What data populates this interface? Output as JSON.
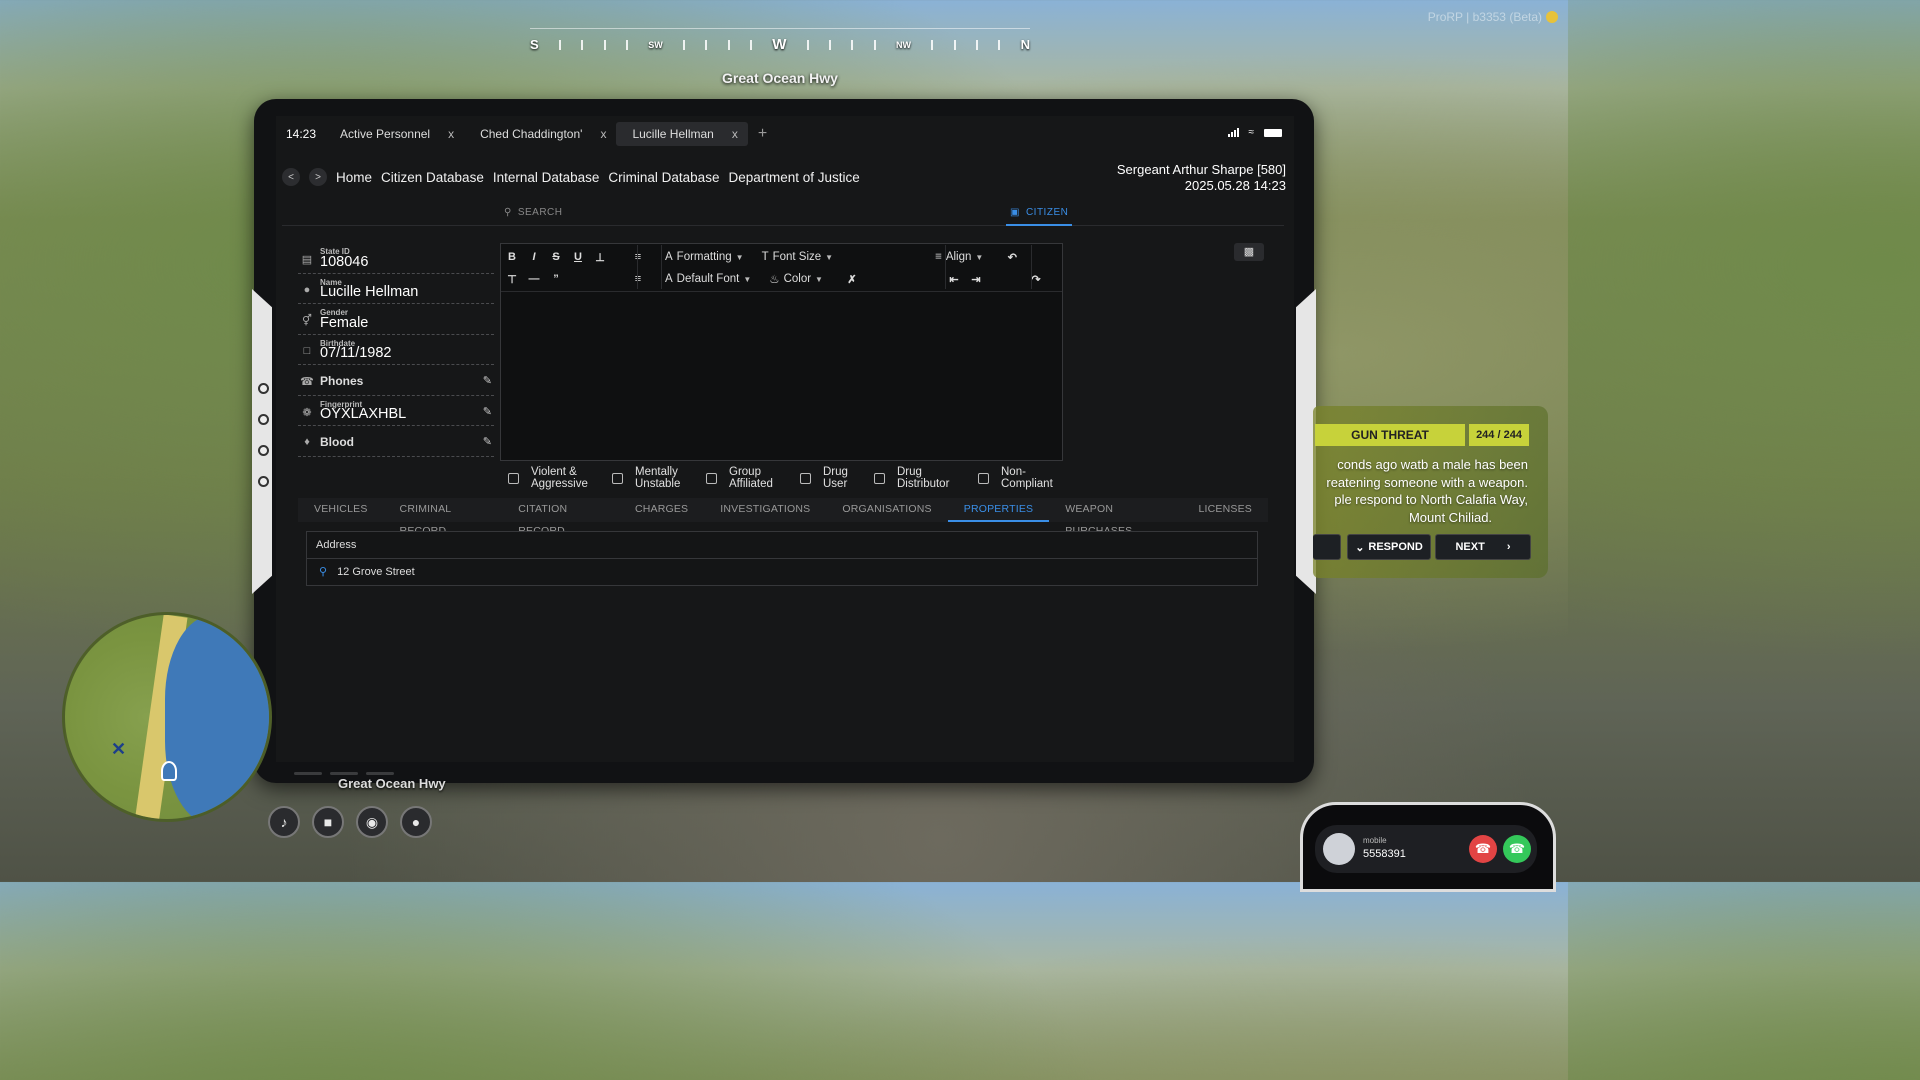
{
  "hud": {
    "compass": [
      "S",
      "SW",
      "W",
      "NW",
      "N"
    ],
    "street_top": "Great Ocean Hwy",
    "street_bottom": "Great Ocean Hwy",
    "watermark": "ProRP | b3353 (Beta)"
  },
  "tablet": {
    "clock": "14:23",
    "tabs": [
      {
        "label": "Active Personnel",
        "close": "x"
      },
      {
        "label": "Ched Chaddington'",
        "close": "x"
      },
      {
        "label": "Lucille Hellman",
        "close": "x"
      }
    ],
    "add_tab": "+",
    "nav": {
      "back": "<",
      "forward": ">",
      "links": [
        "Home",
        "Citizen Database",
        "Internal Database",
        "Criminal Database",
        "Department of Justice"
      ]
    },
    "user": {
      "name": "Sergeant Arthur Sharpe [580]",
      "datetime": "2025.05.28 14:23"
    },
    "search_label": "SEARCH",
    "citizen_tab": "CITIZEN",
    "fields": {
      "state_id": {
        "label": "State ID",
        "value": "108046"
      },
      "name": {
        "label": "Name",
        "value": "Lucille Hellman"
      },
      "gender": {
        "label": "Gender",
        "value": "Female"
      },
      "birthdate": {
        "label": "Birthdate",
        "value": "07/11/1982"
      },
      "phones": {
        "value": "Phones"
      },
      "fingerprint": {
        "label": "Fingerprint",
        "value": "OYXLAXHBL"
      },
      "blood": {
        "value": "Blood"
      }
    },
    "editor": {
      "formatting": "Formatting",
      "font_size": "Font Size",
      "align": "Align",
      "default_font": "Default Font",
      "color": "Color"
    },
    "flags": [
      {
        "line1": "Violent &",
        "line2": "Aggressive"
      },
      {
        "line1": "Mentally",
        "line2": "Unstable"
      },
      {
        "line1": "Group",
        "line2": "Affiliated"
      },
      {
        "line1": "Drug",
        "line2": "User"
      },
      {
        "line1": "Drug",
        "line2": "Distributor"
      },
      {
        "line1": "Non-",
        "line2": "Compliant"
      }
    ],
    "record_tabs": [
      "VEHICLES",
      "CRIMINAL RECORD",
      "CITATION RECORD",
      "CHARGES",
      "INVESTIGATIONS",
      "ORGANISATIONS",
      "PROPERTIES",
      "WEAPON PURCHASES",
      "LICENSES"
    ],
    "active_record_tab": "PROPERTIES",
    "properties": {
      "header": "Address",
      "rows": [
        "12 Grove Street"
      ]
    }
  },
  "call": {
    "title": "GUN THREAT",
    "count": "244 / 244",
    "text_line1": "conds ago watb a male has been",
    "text_line2": "reatening someone with a weapon.",
    "text_line3": "ple respond to North Calafia Way,",
    "text_line4": "Mount Chiliad.",
    "respond": "RESPOND",
    "next": "NEXT"
  },
  "phone": {
    "label": "mobile",
    "number": "5558391"
  },
  "colors": {
    "accent": "#3a8ee6",
    "call": "#c7d23a",
    "decline": "#e24444",
    "accept": "#34c85a"
  }
}
